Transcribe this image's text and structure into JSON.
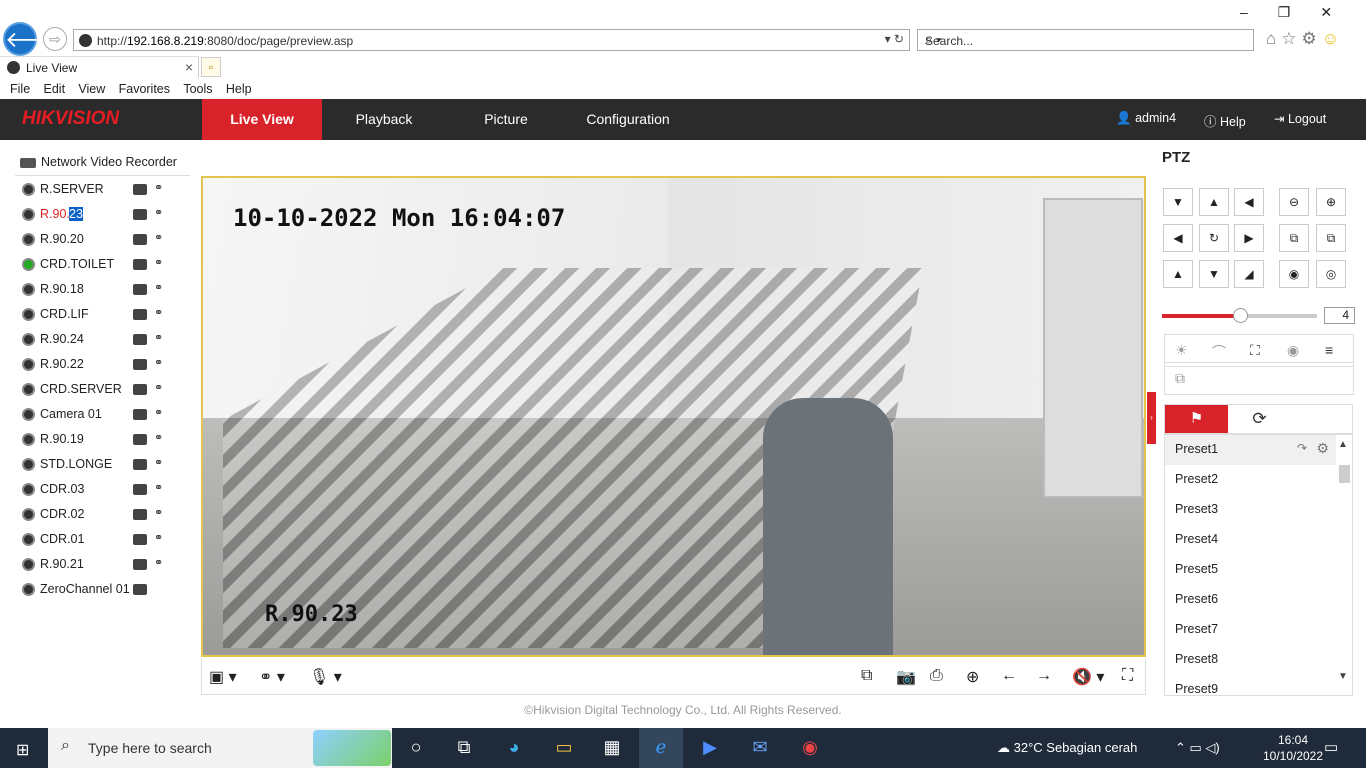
{
  "browser": {
    "url_prefix": "http://",
    "url_host": "192.168.8.219",
    "url_rest": ":8080/doc/page/preview.asp",
    "search_placeholder": "Search...",
    "tab_title": "Live View",
    "menu": [
      "File",
      "Edit",
      "View",
      "Favorites",
      "Tools",
      "Help"
    ]
  },
  "app": {
    "logo_a": "HIK",
    "logo_b": "VISION",
    "nav": [
      "Live View",
      "Playback",
      "Picture",
      "Configuration"
    ],
    "active_nav": "Live View",
    "user": "admin4",
    "help": "Help",
    "logout": "Logout",
    "accent": "#d8232a"
  },
  "tree": {
    "root": "Network Video Recorder",
    "cameras": [
      {
        "name": "R.SERVER",
        "state": "normal"
      },
      {
        "name": "R.90.",
        "highlight": "23",
        "state": "active"
      },
      {
        "name": "R.90.20",
        "state": "normal"
      },
      {
        "name": "CRD.TOILET",
        "state": "green"
      },
      {
        "name": "R.90.18",
        "state": "normal"
      },
      {
        "name": "CRD.LIF",
        "state": "normal"
      },
      {
        "name": "R.90.24",
        "state": "normal"
      },
      {
        "name": "R.90.22",
        "state": "normal"
      },
      {
        "name": "CRD.SERVER",
        "state": "normal"
      },
      {
        "name": "Camera 01",
        "state": "normal"
      },
      {
        "name": "R.90.19",
        "state": "normal"
      },
      {
        "name": "STD.LONGE",
        "state": "normal"
      },
      {
        "name": "CDR.03",
        "state": "normal"
      },
      {
        "name": "CDR.02",
        "state": "normal"
      },
      {
        "name": "CDR.01",
        "state": "normal"
      },
      {
        "name": "R.90.21",
        "state": "normal"
      },
      {
        "name": "ZeroChannel 01",
        "state": "normal"
      }
    ]
  },
  "video": {
    "timestamp": "10-10-2022 Mon 16:04:07",
    "osd_name": "R.90.23"
  },
  "footer": "©Hikvision Digital Technology Co., Ltd. All Rights Reserved.",
  "ptz": {
    "title": "PTZ",
    "speed": "4",
    "presets": [
      "Preset1",
      "Preset2",
      "Preset3",
      "Preset4",
      "Preset5",
      "Preset6",
      "Preset7",
      "Preset8",
      "Preset9"
    ]
  },
  "taskbar": {
    "search_text": "Type here to search",
    "weather": "32°C  Sebagian cerah",
    "time": "16:04",
    "date": "10/10/2022"
  }
}
